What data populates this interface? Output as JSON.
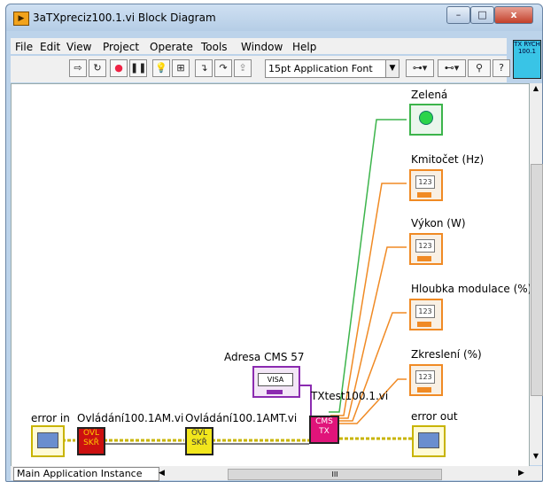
{
  "window": {
    "title": "3aTXpreciz100.1.vi Block Diagram",
    "app_icon": "labview-icon",
    "controls": {
      "minimize": "–",
      "maximize": "□",
      "close": "x"
    }
  },
  "menu": {
    "items": [
      "File",
      "Edit",
      "View",
      "Project",
      "Operate",
      "Tools",
      "Window",
      "Help"
    ]
  },
  "toolbar": {
    "font": "15pt Application Font"
  },
  "vi_icon": {
    "text": "TX RYCH 100.1"
  },
  "diagram": {
    "indicators": {
      "zelena": "Zelená",
      "kmitocet": "Kmitočet (Hz)",
      "vykon": "Výkon (W)",
      "hloubka": "Hloubka modulace (%)",
      "zkresleni": "Zkreslení (%)"
    },
    "numeric_text": "123",
    "adresa_label": "Adresa CMS 57",
    "visa_text": "VISA",
    "txtest_label": "TXtest100.1.vi",
    "cms_block": "CMS TX",
    "error_in": "error in",
    "error_out": "error out",
    "ovl1_label": "Ovládání100.1AM.vi",
    "ovl1_block": "OVL SKŘ",
    "ovl2_label": "Ovládání100.1AMT.vi",
    "ovl2_block": "OVL SKŘ"
  },
  "status": {
    "instance": "Main Application Instance",
    "scroll_marker": "III"
  },
  "colors": {
    "wire_orange": "#f08a24",
    "wire_green": "#3cb44b",
    "wire_purple": "#8b2bb0",
    "error_wire": "#c8b400",
    "ovl1": "#cc1010",
    "ovl2": "#f2e61c",
    "cms": "#e0147a"
  }
}
